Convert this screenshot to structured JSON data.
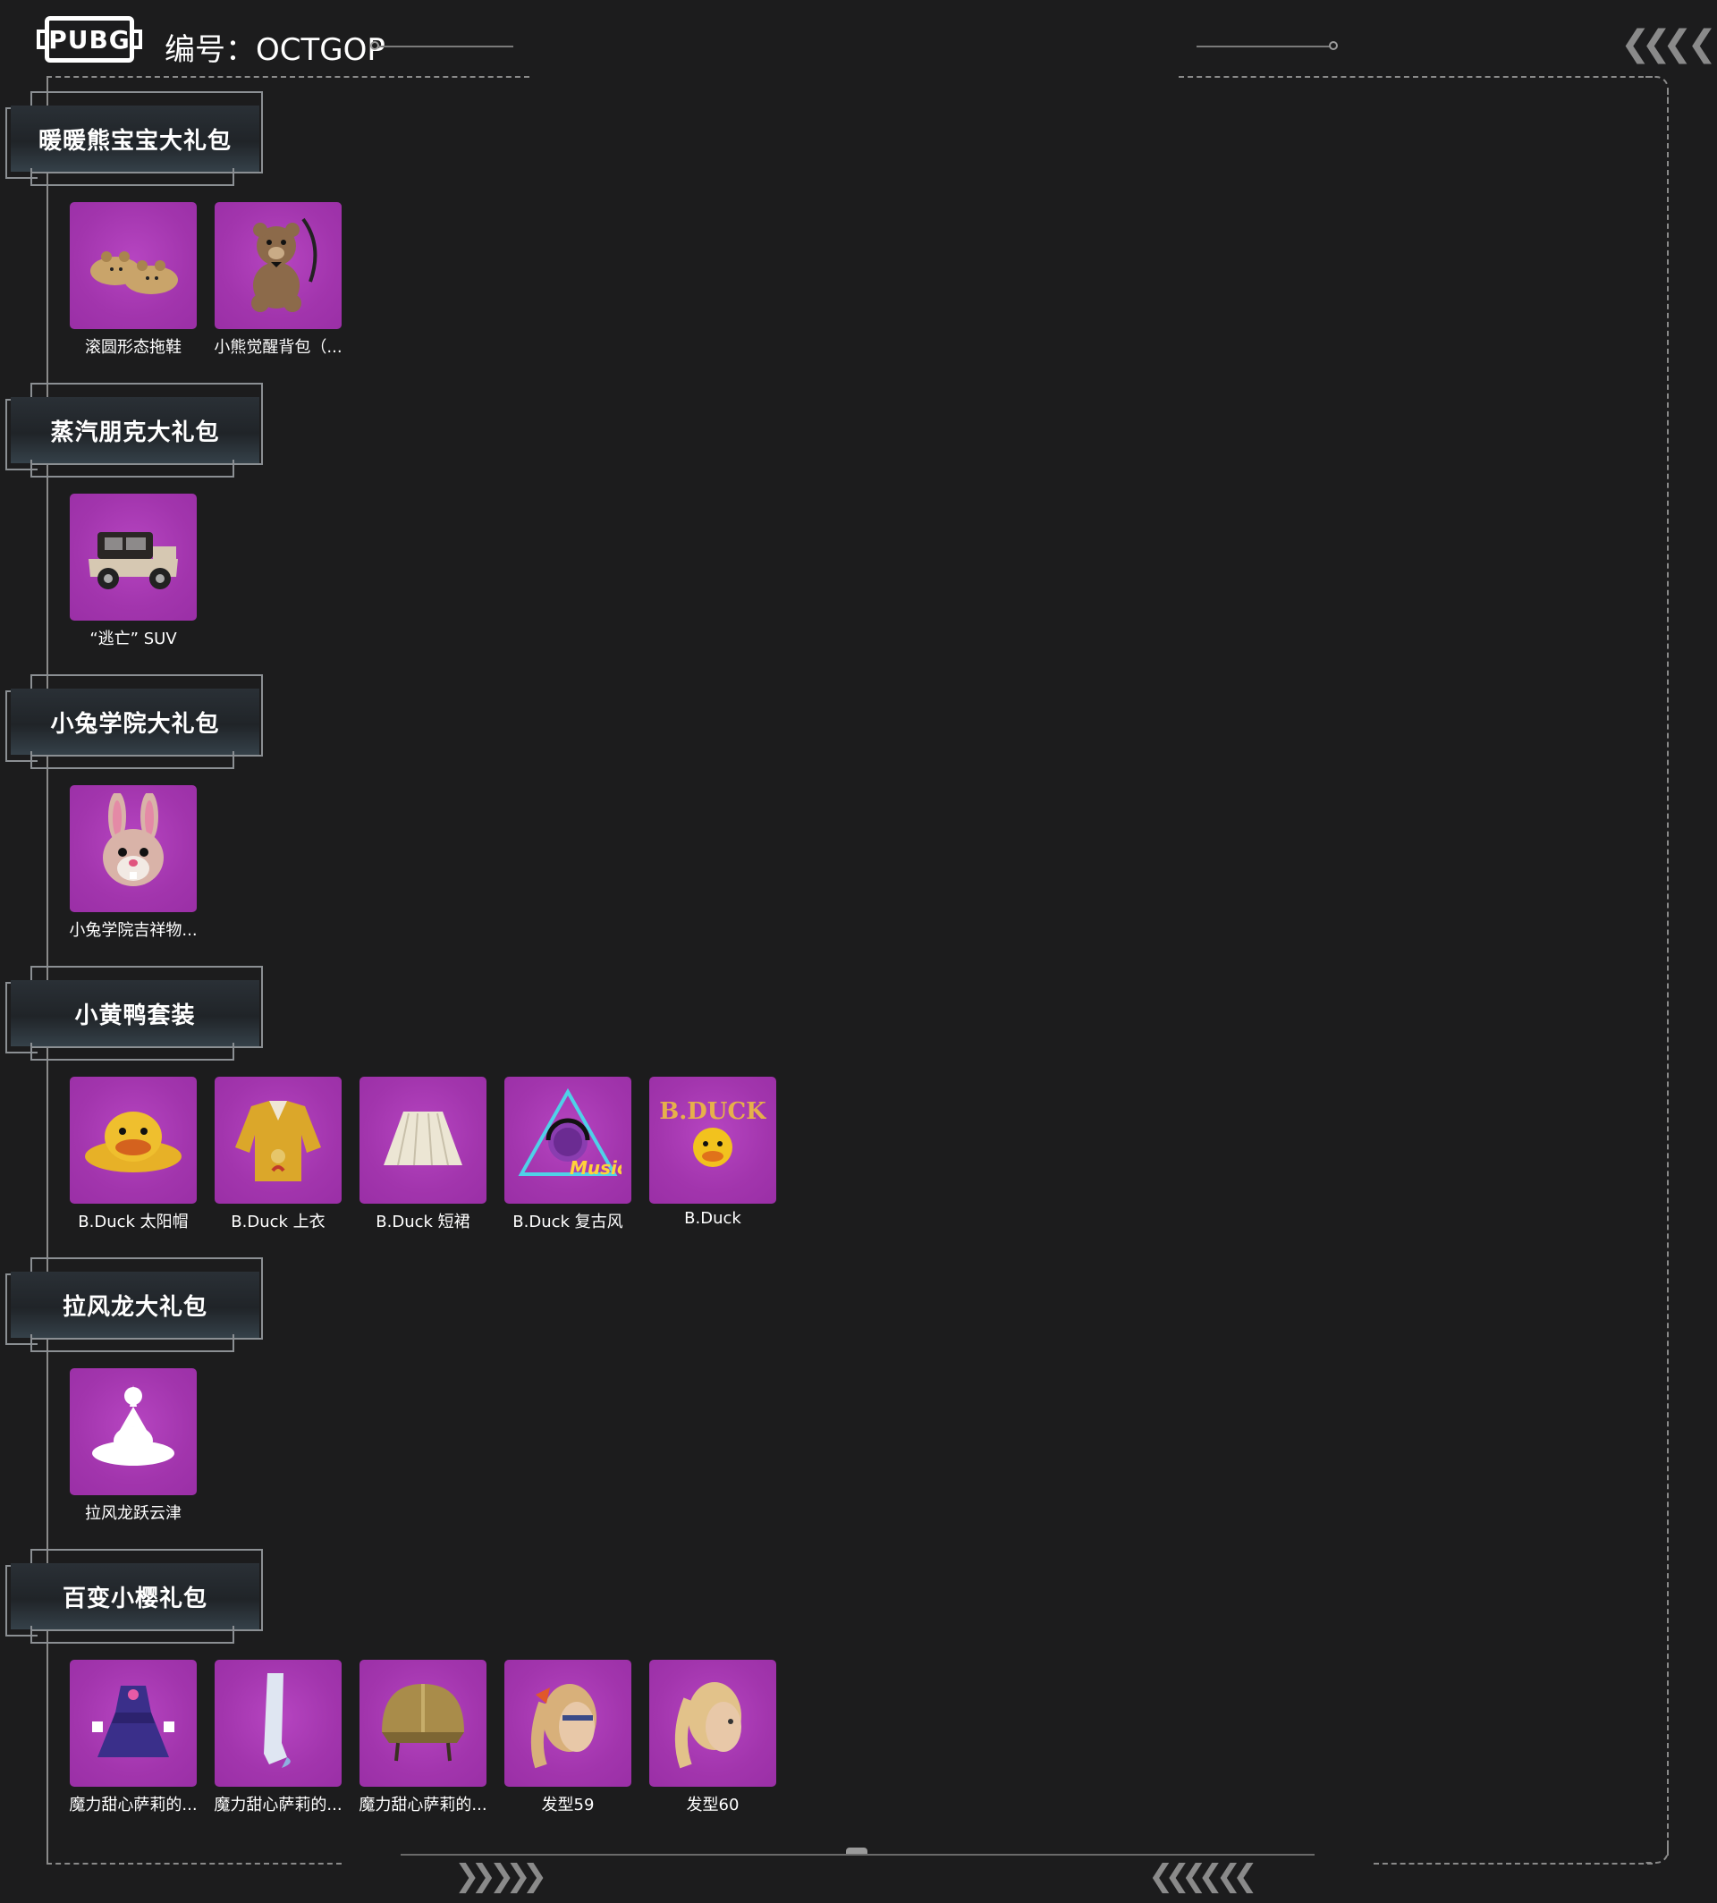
{
  "header": {
    "logo_text": "PUBG",
    "code_prefix": "编号：",
    "code_value": "OCTGOP"
  },
  "colors": {
    "tile_bg": "#a235ad",
    "background": "#1c1c1d",
    "frame": "#8a8a8a"
  },
  "sections": [
    {
      "title": "暖暖熊宝宝大礼包",
      "items": [
        {
          "label": "滚圆形态拖鞋",
          "icon": "bear-slippers-icon"
        },
        {
          "label": "小熊觉醒背包（...",
          "icon": "teddy-bear-backpack-icon"
        }
      ]
    },
    {
      "title": "蒸汽朋克大礼包",
      "items": [
        {
          "label": "“逃亡” SUV",
          "icon": "vintage-car-icon"
        }
      ]
    },
    {
      "title": "小兔学院大礼包",
      "items": [
        {
          "label": "小兔学院吉祥物...",
          "icon": "bunny-mascot-icon"
        }
      ]
    },
    {
      "title": "小黄鸭套装",
      "items": [
        {
          "label": "B.Duck 太阳帽",
          "icon": "duck-sun-hat-icon"
        },
        {
          "label": "B.Duck 上衣",
          "icon": "yellow-jacket-icon"
        },
        {
          "label": "B.Duck 短裙",
          "icon": "pleated-skirt-icon"
        },
        {
          "label": "B.Duck 复古风",
          "icon": "music-duck-emblem-icon"
        },
        {
          "label": "B.Duck",
          "icon": "bduck-logo-icon"
        }
      ]
    },
    {
      "title": "拉风龙大礼包",
      "items": [
        {
          "label": "拉风龙跃云津",
          "icon": "meditation-emote-icon"
        }
      ]
    },
    {
      "title": "百变小樱礼包",
      "items": [
        {
          "label": "魔力甜心萨莉的...",
          "icon": "magical-dress-icon"
        },
        {
          "label": "魔力甜心萨莉的...",
          "icon": "long-stockings-icon"
        },
        {
          "label": "魔力甜心萨莉的...",
          "icon": "gold-helmet-icon"
        },
        {
          "label": "发型59",
          "icon": "blonde-ponytail-bow-icon"
        },
        {
          "label": "发型60",
          "icon": "blonde-ponytail-icon"
        }
      ]
    }
  ]
}
